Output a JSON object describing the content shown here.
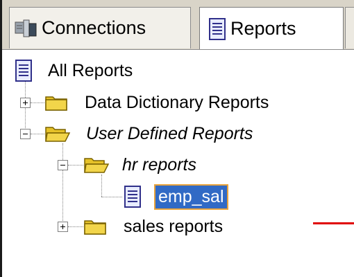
{
  "tabs": [
    {
      "label": "Connections",
      "icon": "connections-icon"
    },
    {
      "label": "Reports",
      "icon": "reports-icon",
      "active": true
    }
  ],
  "tree": {
    "root": {
      "label": "All Reports",
      "icon": "report-document-icon"
    },
    "data_dictionary": {
      "label": "Data Dictionary Reports",
      "icon": "folder-closed-icon",
      "expanded": false
    },
    "user_defined": {
      "label": "User Defined Reports",
      "icon": "folder-open-icon",
      "expanded": true
    },
    "hr_reports": {
      "label": "hr reports",
      "icon": "folder-open-icon",
      "expanded": true
    },
    "emp_sal": {
      "label": "emp_sal",
      "icon": "report-document-icon",
      "selected": true
    },
    "sales_reports": {
      "label": "sales reports",
      "icon": "folder-closed-icon",
      "expanded": false
    }
  },
  "colors": {
    "selection": "#316ac5",
    "selection_border": "#e8a33c",
    "annotation_line": "#e00000",
    "folder": "#e6c229"
  }
}
